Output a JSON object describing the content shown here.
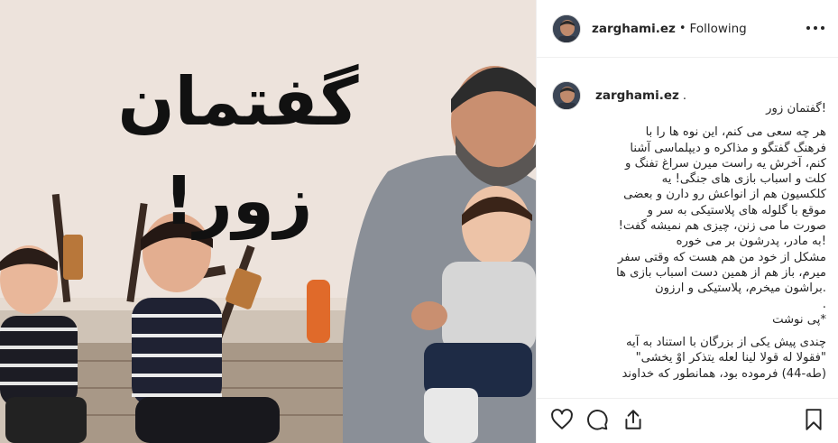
{
  "post": {
    "overlay_text": "گفتمان زور!",
    "author": "zarghami.ez",
    "separator": "•",
    "follow_status": "Following",
    "caption_suffix": "."
  },
  "caption": {
    "lines": [
      "!گفتمان زور",
      "هر چه سعی می کنم، این نوه ها را با",
      "فرهنگ گفتگو و مذاکره و دیپلماسی آشنا",
      "کنم، آخرش یه راست میرن سراغ تفنگ و",
      "کلت و اسباب بازی های جنگی! یه",
      "کلکسیون هم از انواعش رو دارن و بعضی",
      "موقع با گلوله های پلاستیکی به سر و",
      "صورت ما می زنن، چیزی هم نمیشه گفت!",
      "!به مادر، پدرشون بر می خوره",
      "مشکل از خود من هم هست که وقتی سفر",
      "میرم، باز هم از همین دست اسباب بازی ها",
      ".براشون میخرم، پلاستیکی و ارزون",
      ".",
      "*پی نوشت",
      "",
      "چندی پیش یکی از بزرگان با استناد به آیه",
      "\"فقولا له قولا لینا لعله یتذکر اوْ یخشی\"",
      "(طه-44) فرموده بود، همانطور که خداوند"
    ]
  },
  "icons": {
    "more": "more-options-icon",
    "like": "heart-icon",
    "comment": "comment-icon",
    "share": "share-icon",
    "save": "bookmark-icon"
  },
  "colors": {
    "text": "#262626",
    "border": "#efefef",
    "photo_wall": "#ede4dd"
  }
}
